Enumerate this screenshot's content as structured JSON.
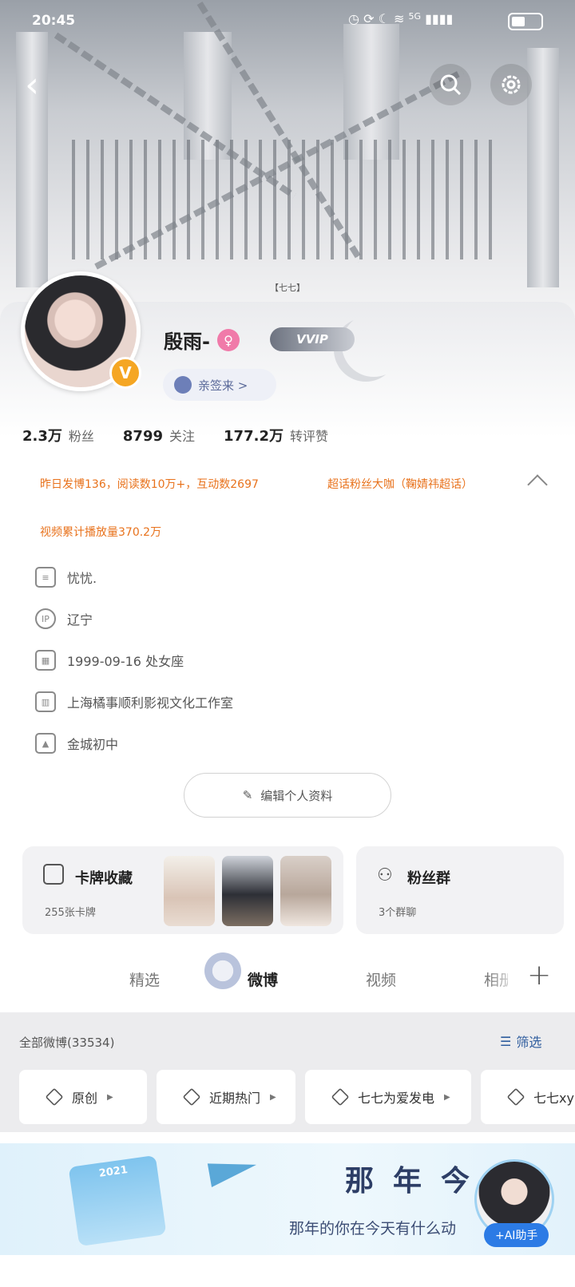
{
  "status_bar": {
    "time": "20:45",
    "network": "5G"
  },
  "banner": {
    "caption": "【七七】"
  },
  "profile": {
    "username": "殷雨-",
    "vip_label": "VVIP",
    "signed_label": "亲签来 >",
    "stats": [
      {
        "num": "2.3万",
        "label": "粉丝"
      },
      {
        "num": "8799",
        "label": "关注"
      },
      {
        "num": "177.2万",
        "label": "转评赞"
      }
    ],
    "highlights": {
      "yesterday": "昨日发博136，阅读数10万+，互动数2697",
      "superfan": "超话粉丝大咖（鞠婧祎超话）",
      "video": "视频累计播放量370.2万"
    },
    "info": {
      "bio": "忧忧.",
      "ip_label": "IP",
      "location": "辽宁",
      "birthday": "1999-09-16 处女座",
      "company": "上海橘事顺利影视文化工作室",
      "school": "金城初中"
    },
    "edit_label": "编辑个人资料"
  },
  "cards": {
    "card_collection": {
      "title": "卡牌收藏",
      "sub": "255张卡牌"
    },
    "fan_group": {
      "title": "粉丝群",
      "sub": "3个群聊"
    }
  },
  "tabs": [
    "精选",
    "微博",
    "视频",
    "相册"
  ],
  "filter": {
    "all_label": "全部微博(33534)",
    "filter_label": "筛选",
    "chips": [
      "原创",
      "近期热门",
      "七七为爱发电",
      "七七xy"
    ]
  },
  "promo": {
    "calendar_year": "2021",
    "title": "那年今",
    "subtitle": "那年的你在今天有什么动",
    "ai_label": "+AI助手"
  },
  "colors": {
    "accent_orange": "#e8721c",
    "link_blue": "#2f5d9e",
    "vip_gradient_start": "#6d7380"
  }
}
